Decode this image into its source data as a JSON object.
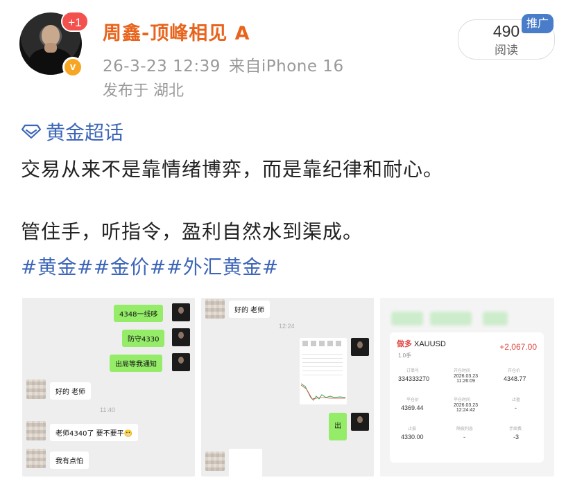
{
  "post": {
    "author": "周鑫-顶峰相见 A",
    "follow_badge": "+1",
    "verified_badge": "v",
    "timestamp": "26-3-23 12:39",
    "source": "来自iPhone 16",
    "location": "发布于 湖北",
    "read_count": "490",
    "read_label": "阅读",
    "promo_tag": "推广",
    "topic": "黄金超话",
    "line1": "交易从来不是靠情绪博弈，而是靠纪律和耐心。",
    "line2": "管住手，听指令，盈利自然水到渠成。",
    "hashtags": "#黄金##金价##外汇黄金#"
  },
  "images": {
    "chat1": {
      "msg1": "4348一线哆",
      "msg2": "防守4330",
      "msg3": "出局等我通知",
      "reply1": "好的 老师",
      "time": "11:40",
      "reply2": "老师4340了 要不要平😬",
      "reply3": "我有点怕"
    },
    "chat2": {
      "reply1": "好的 老师",
      "time": "12:24",
      "msg1": "出"
    },
    "trade": {
      "side": "做多",
      "symbol": "XAUUSD",
      "pnl": "+2,067.00",
      "lot": "1.0手",
      "order_no": "334333270",
      "open_time": "2026.03.23\n11:26:09",
      "open_price": "4348.77",
      "close_price": "4369.44",
      "close_time": "2026.03.23\n12:24:42",
      "take_profit": "-",
      "stop_loss": "4330.00",
      "overnight": "-",
      "fee": "-3",
      "labels": {
        "order_no": "订单号",
        "open_time": "开仓时间",
        "open_price": "开仓价",
        "close_price": "平仓价",
        "close_time": "平仓时间",
        "take_profit": "止盈",
        "stop_loss": "止损",
        "overnight": "隔夜利息",
        "fee": "手续费"
      }
    }
  },
  "colors": {
    "username": "#e8641c",
    "link": "#3d66b8",
    "promo": "#4a7dc9",
    "badge_red": "#f2514d",
    "badge_gold": "#f6a623",
    "chat_green": "#95ec69",
    "profit_red": "#e0463f"
  },
  "icons": {
    "topic": "diamond-icon"
  }
}
